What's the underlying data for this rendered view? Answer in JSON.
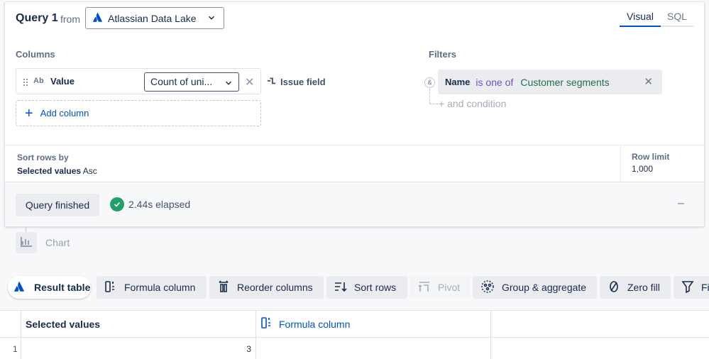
{
  "query": {
    "title": "Query 1",
    "from_label": "from",
    "source": "Atlassian Data Lake",
    "tabs": [
      {
        "label": "Visual",
        "active": true
      },
      {
        "label": "SQL",
        "active": false
      }
    ]
  },
  "columns": {
    "label": "Columns",
    "items": [
      {
        "type_badge": "Ab",
        "name": "Value",
        "aggregation": "Count of uni..."
      }
    ],
    "issue_field_label": "Issue field",
    "add_column_label": "Add column"
  },
  "filters": {
    "label": "Filters",
    "conjunction": "&",
    "items": [
      {
        "field": "Name",
        "operator": "is one of",
        "value": "Customer segments"
      }
    ],
    "and_condition_label": "+ and condition"
  },
  "sort": {
    "label": "Sort rows by",
    "field": "Selected values",
    "direction": "Asc"
  },
  "row_limit": {
    "label": "Row limit",
    "value": "1,000"
  },
  "status": {
    "button": "Query finished",
    "elapsed": "2.44s elapsed",
    "collapse": "–"
  },
  "chart": {
    "label": "Chart"
  },
  "toolbar": {
    "result_table": "Result table",
    "formula_column": "Formula column",
    "reorder_columns": "Reorder columns",
    "sort_rows": "Sort rows",
    "pivot": "Pivot",
    "group_aggregate": "Group & aggregate",
    "zero_fill": "Zero fill",
    "filter": "Fi"
  },
  "table": {
    "headers": [
      "Selected values",
      "Formula column"
    ],
    "rows": [
      {
        "index": "1",
        "selected_values": "3",
        "formula": ""
      }
    ]
  },
  "colors": {
    "accent": "#0052cc",
    "success": "#22a06b",
    "operator": "#6554c0",
    "filter_value": "#216e4e"
  }
}
